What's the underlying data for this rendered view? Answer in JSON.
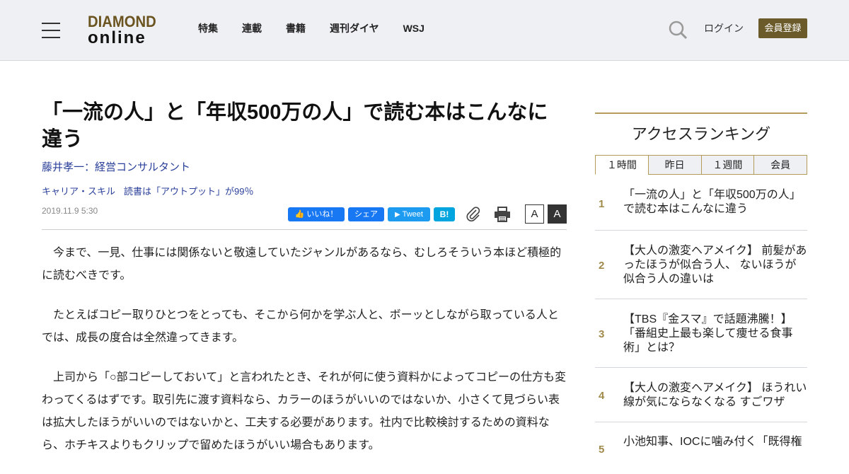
{
  "header": {
    "logo_line1": "DIAMOND",
    "logo_line2": "online",
    "nav": [
      "特集",
      "連載",
      "書籍",
      "週刊ダイヤ",
      "WSJ"
    ],
    "login": "ログイン",
    "register": "会員登録"
  },
  "article": {
    "title": "「一流の人」と「年収500万の人」で読む本はこんなに違う",
    "author": "藤井孝一：経営コンサルタント",
    "breadcrumbs": [
      "キャリア・スキル",
      "読書は「アウトプット」が99％"
    ],
    "date": "2019.11.9 5:30",
    "share": {
      "like": "いいね！",
      "share": "シェア",
      "tweet": "Tweet",
      "hatena": "B!"
    },
    "font_small": "A",
    "font_large": "A",
    "paragraphs": [
      "今まで、一見、仕事には関係ないと敬遠していたジャンルがあるなら、むしろそういう本ほど積極的に読むべきです。",
      "たとえばコピー取りひとつをとっても、そこから何かを学ぶ人と、ボーッとしながら取っている人とでは、成長の度合は全然違ってきます。",
      "上司から「○部コピーしておいて」と言われたとき、それが何に使う資料かによってコピーの仕方も変わってくるはずです。取引先に渡す資料なら、カラーのほうがいいのではないか、小さくて見づらい表は拡大したほうがいいのではないかと、工夫する必要があります。社内で比較検討するための資料なら、ホチキスよりもクリップで留めたほうがいい場合もあります。"
    ]
  },
  "sidebar": {
    "ranking_title": "アクセスランキング",
    "tabs": [
      "１時間",
      "昨日",
      "１週間",
      "会員"
    ],
    "active_tab": "１時間",
    "items": [
      {
        "rank": "1",
        "text": "「一流の人」と「年収500万の人」で読む本はこんなに違う"
      },
      {
        "rank": "2",
        "text": "【大人の激変ヘアメイク】 前髪があったほうが似合う人、 ないほうが似合う人の違いは"
      },
      {
        "rank": "3",
        "text": "【TBS『金スマ』で話題沸騰！】「番組史上最も楽して痩せる食事術」とは？"
      },
      {
        "rank": "4",
        "text": "【大人の激変ヘアメイク】 ほうれい線が気にならなくなる すごワザ"
      },
      {
        "rank": "5",
        "text": "小池知事、IOCに噛み付く「既得権"
      }
    ]
  },
  "colors": {
    "accent_gold": "#b39c5a",
    "register_bg": "#6b5a2a",
    "link_blue": "#2a3f9a"
  }
}
